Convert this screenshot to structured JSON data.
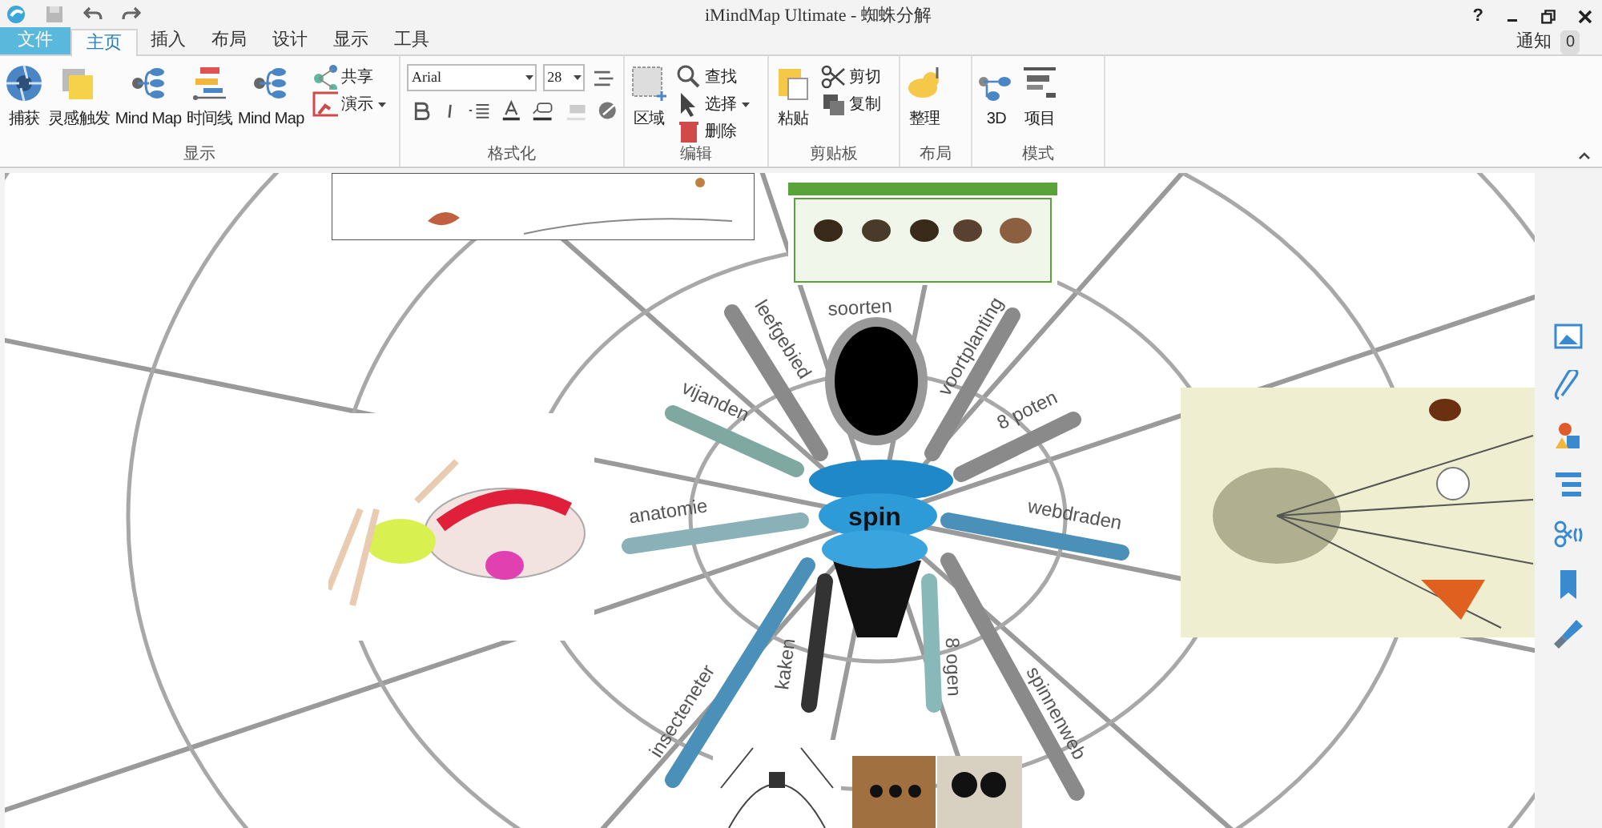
{
  "window": {
    "title": "iMindMap Ultimate - 蜘蛛分解",
    "help": "?",
    "notice_label": "通知",
    "notice_count": "0"
  },
  "tabs": [
    {
      "label": "文件",
      "kind": "file",
      "selected": false
    },
    {
      "label": "主页",
      "kind": "tab",
      "selected": true
    },
    {
      "label": "插入",
      "kind": "tab",
      "selected": false
    },
    {
      "label": "布局",
      "kind": "tab",
      "selected": false
    },
    {
      "label": "设计",
      "kind": "tab",
      "selected": false
    },
    {
      "label": "显示",
      "kind": "tab",
      "selected": false
    },
    {
      "label": "工具",
      "kind": "tab",
      "selected": false
    }
  ],
  "ribbon_groups": [
    {
      "label": "显示",
      "kind": "buttons",
      "buttons": [
        {
          "label": "捕获",
          "kind": "large"
        },
        {
          "label": "灵感触发",
          "kind": "large"
        },
        {
          "label": "Mind Map",
          "kind": "large"
        },
        {
          "label": "时间线",
          "kind": "large"
        },
        {
          "label": "Mind Map",
          "kind": "large"
        },
        {
          "label": "共享",
          "kind": "small"
        },
        {
          "label": "演示",
          "kind": "small",
          "dropdown": true
        }
      ]
    },
    {
      "label": "格式化",
      "kind": "format",
      "font": "Arial",
      "size": "28"
    },
    {
      "label": "编辑",
      "kind": "buttons",
      "buttons": [
        {
          "label": "区域",
          "kind": "large"
        },
        {
          "label": "查找",
          "kind": "small"
        },
        {
          "label": "选择",
          "kind": "small",
          "dropdown": true
        },
        {
          "label": "删除",
          "kind": "small"
        }
      ]
    },
    {
      "label": "剪贴板",
      "kind": "buttons",
      "buttons": [
        {
          "label": "粘贴",
          "kind": "large"
        },
        {
          "label": "剪切",
          "kind": "small"
        },
        {
          "label": "复制",
          "kind": "small"
        }
      ]
    },
    {
      "label": "布局",
      "kind": "buttons",
      "buttons": [
        {
          "label": "整理",
          "kind": "large"
        }
      ]
    },
    {
      "label": "模式",
      "kind": "buttons",
      "buttons": [
        {
          "label": "3D",
          "kind": "large"
        },
        {
          "label": "项目",
          "kind": "large"
        }
      ]
    }
  ],
  "mind_map": {
    "center": "spin",
    "branches": [
      {
        "label": "leefgebied"
      },
      {
        "label": "soorten"
      },
      {
        "label": "voortplanting"
      },
      {
        "label": "vijanden"
      },
      {
        "label": "8 poten"
      },
      {
        "label": "anatomie"
      },
      {
        "label": "webdraden"
      },
      {
        "label": "insecteneter"
      },
      {
        "label": "kaken"
      },
      {
        "label": "8 ogen"
      },
      {
        "label": "spinnenweb"
      }
    ]
  }
}
